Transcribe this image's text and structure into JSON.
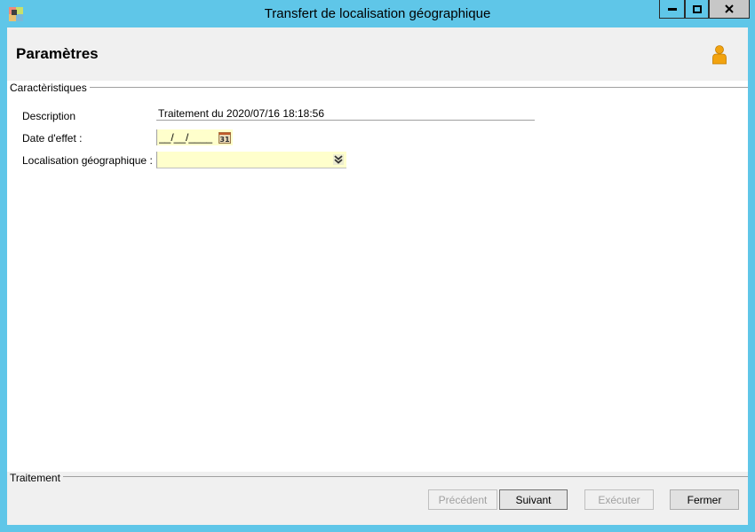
{
  "window": {
    "title": "Transfert de localisation géographique",
    "controls": [
      "minimize",
      "maximize",
      "close"
    ]
  },
  "header": {
    "title": "Paramètres",
    "user_icon": "user-icon"
  },
  "characteristics": {
    "group_label": "Caractèristiques",
    "description": {
      "label": "Description",
      "value": "Traitement du 2020/07/16 18:18:56"
    },
    "effective_date": {
      "label": "Date d'effet :",
      "value": "__/__/____",
      "calendar_label": "31"
    },
    "location": {
      "label": "Localisation géographique :",
      "value": ""
    }
  },
  "processing": {
    "group_label": "Traitement"
  },
  "buttons": {
    "previous": "Précédent",
    "next": "Suivant",
    "execute": "Exécuter",
    "close": "Fermer"
  },
  "colors": {
    "frame": "#5fc6e8",
    "required_field": "#ffffcc",
    "panel": "#f0f0f0"
  }
}
